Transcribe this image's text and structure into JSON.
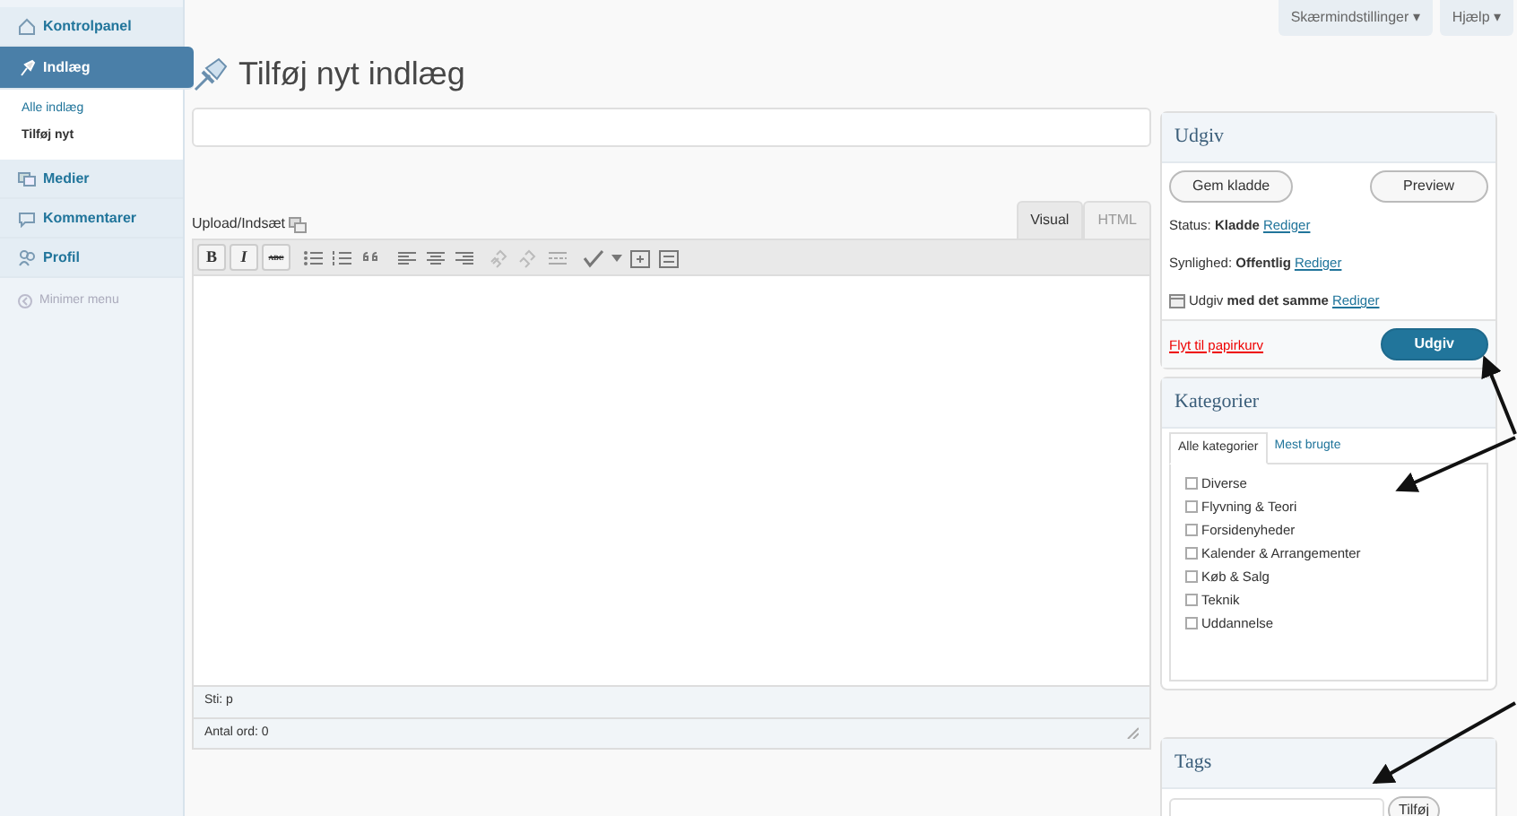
{
  "sidebar": {
    "items": [
      {
        "label": "Kontrolpanel",
        "selected": false
      },
      {
        "label": "Indlæg",
        "selected": true,
        "children": [
          {
            "label": "Alle indlæg",
            "selected": false
          },
          {
            "label": "Tilføj nyt",
            "selected": true
          }
        ]
      },
      {
        "label": "Medier",
        "selected": false
      },
      {
        "label": "Kommentarer",
        "selected": false
      },
      {
        "label": "Profil",
        "selected": false
      }
    ],
    "collapse": "Minimer menu"
  },
  "header_buttons": [
    {
      "label": "Skærmindstillinger",
      "caret": "▾"
    },
    {
      "label": "Hjælp",
      "caret": "▾"
    }
  ],
  "page_title": "Tilføj nyt indlæg",
  "upload_label": "Upload/Indsæt",
  "editor_tabs": [
    {
      "label": "Visual",
      "selected": true
    },
    {
      "label": "HTML",
      "selected": false
    }
  ],
  "toolbar_text_buttons": [
    {
      "label": "B"
    },
    {
      "label": "I"
    },
    {
      "label": "ABC"
    }
  ],
  "editor_path": "Sti: p",
  "word_count": "Antal ord: 0",
  "publish": {
    "title": "Udgiv",
    "save_draft": "Gem kladde",
    "preview": "Preview",
    "rows": [
      {
        "label": "Status:",
        "value": "Kladde",
        "link": "Rediger"
      },
      {
        "label": "Synlighed:",
        "value": "Offentlig",
        "link": "Rediger"
      },
      {
        "label": "Udgiv",
        "value": "med det samme",
        "link": "Rediger"
      }
    ],
    "trash": "Flyt til papirkurv",
    "publish_button": "Udgiv"
  },
  "categories": {
    "title": "Kategorier",
    "tabs": [
      {
        "label": "Alle kategorier",
        "selected": true
      },
      {
        "label": "Mest brugte",
        "selected": false
      }
    ],
    "items": [
      {
        "label": "Diverse",
        "checked": false
      },
      {
        "label": "Flyvning & Teori",
        "checked": false
      },
      {
        "label": "Forsidenyheder",
        "checked": false
      },
      {
        "label": "Kalender & Arrangementer",
        "checked": false
      },
      {
        "label": "Køb & Salg",
        "checked": false
      },
      {
        "label": "Teknik",
        "checked": false
      },
      {
        "label": "Uddannelse",
        "checked": false
      }
    ]
  },
  "tags": {
    "title": "Tags",
    "button": "Tilføj"
  }
}
